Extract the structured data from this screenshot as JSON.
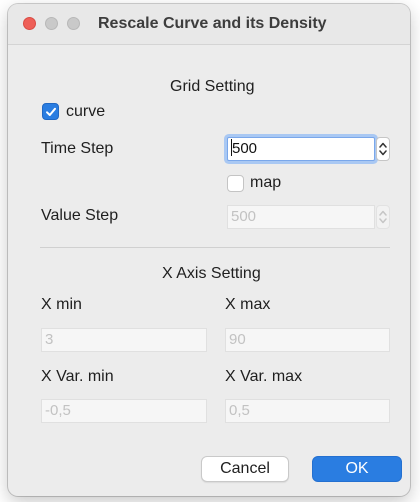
{
  "window": {
    "title": "Rescale Curve and its Density"
  },
  "grid_setting": {
    "title": "Grid Setting",
    "curve_checkbox": {
      "label": "curve",
      "checked": true
    },
    "time_step": {
      "label": "Time Step",
      "value": "500"
    },
    "map_checkbox": {
      "label": "map",
      "checked": false
    },
    "value_step": {
      "label": "Value Step",
      "value": "500"
    }
  },
  "x_axis_setting": {
    "title": "X Axis Setting",
    "x_min": {
      "label": "X min",
      "value": "3"
    },
    "x_max": {
      "label": "X max",
      "value": "90"
    },
    "x_var_min": {
      "label": "X Var. min",
      "value": "-0,5"
    },
    "x_var_max": {
      "label": "X Var. max",
      "value": "0,5"
    }
  },
  "buttons": {
    "cancel": "Cancel",
    "ok": "OK"
  },
  "colors": {
    "accent": "#2a7de1",
    "close_button": "#ee5f57",
    "window_background": "#ececec"
  },
  "icons": {
    "close": "close-traffic-light",
    "minimize": "minimize-traffic-light",
    "zoom": "zoom-traffic-light",
    "checkmark": "checkmark-icon",
    "stepper": "chevron-up-down-icon"
  }
}
